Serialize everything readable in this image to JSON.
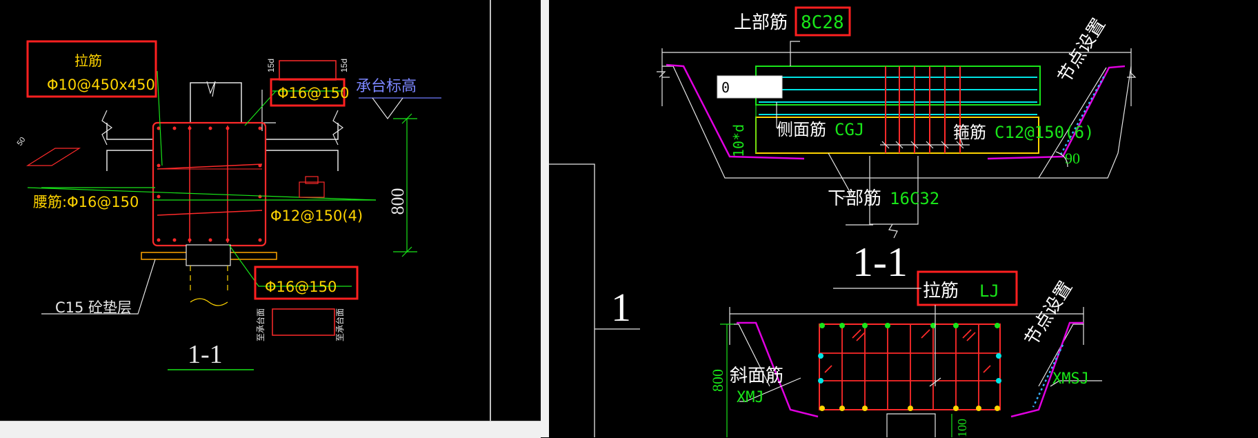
{
  "left_drawing": {
    "tie_bar_label": "拉筋",
    "tie_bar_spec": "Φ10@450x450",
    "top_bar_spec": "Φ16@150",
    "cap_elevation_label": "承台标高",
    "waist_bar_spec": "腰筋:Φ16@150",
    "stirrup_spec": "Φ12@150(4)",
    "bottom_bar_spec": "Φ16@150",
    "height_dim": "800",
    "cushion_label": "C15 砼垫层",
    "section_title": "1-1",
    "anchor_left_label": "15d",
    "anchor_right_label": "15d",
    "side_label": "50",
    "bottom_note_left": "至承台面",
    "bottom_note_right": "至承台面"
  },
  "right_drawing": {
    "top_bar_label": "上部筋",
    "top_bar_value": "8C28",
    "input_value": "0",
    "side_bar_label": "侧面筋",
    "side_bar_value": "CGJ",
    "stirrup_label": "箍筋",
    "stirrup_value": "C12@150(6)",
    "angle_value": "90",
    "bottom_bar_label": "下部筋",
    "bottom_bar_value": "16C32",
    "node_setting_label": "节点设置",
    "dim_10d": "10*d",
    "section_title": "1-1",
    "large_number": "1",
    "tie_bar_label": "拉筋",
    "tie_bar_value": "LJ",
    "node_setting_label_2": "节点设置",
    "slope_bar_label": "斜面筋",
    "slope_bar_value": "XMJ",
    "slope_bar_right_value": "XMSJ",
    "height_dim": "800",
    "dim_100": "100"
  },
  "colors": {
    "background": "#000000",
    "highlight_box": "#ff2020",
    "rebar_red": "#ff2a2a",
    "green": "#19e619",
    "yellow": "#ffd400",
    "cyan": "#00e5e5",
    "magenta": "#e000e0",
    "white": "#ffffff"
  }
}
